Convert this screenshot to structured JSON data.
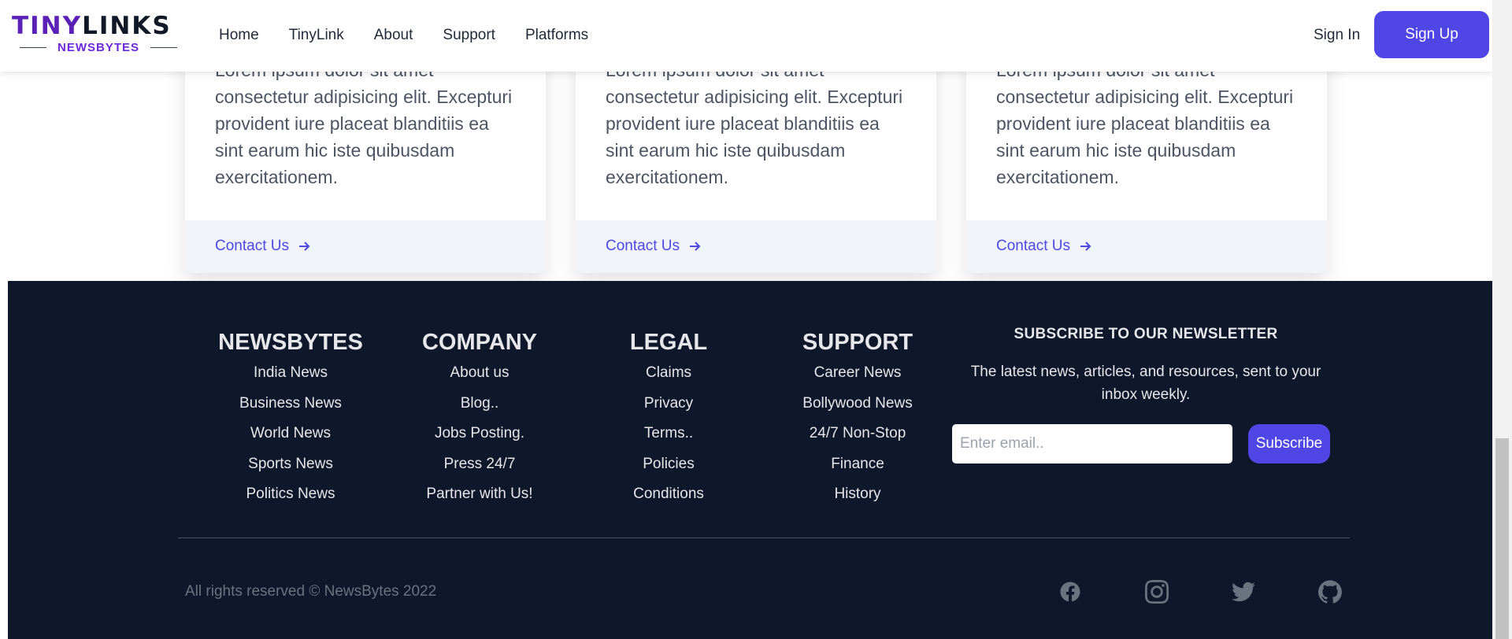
{
  "header": {
    "logo": {
      "brand_part1": "TINY",
      "brand_part2": "LINKS",
      "subtitle": "NEWSBYTES"
    },
    "nav": [
      {
        "label": "Home"
      },
      {
        "label": "TinyLink"
      },
      {
        "label": "About"
      },
      {
        "label": "Support"
      },
      {
        "label": "Platforms"
      }
    ],
    "signin_label": "Sign In",
    "signup_label": "Sign Up"
  },
  "cards": [
    {
      "text": "Lorem ipsum dolor sit amet consectetur adipisicing elit. Excepturi provident iure placeat blanditiis ea sint earum hic iste quibusdam exercitationem.",
      "link_label": "Contact Us"
    },
    {
      "text": "Lorem ipsum dolor sit amet consectetur adipisicing elit. Excepturi provident iure placeat blanditiis ea sint earum hic iste quibusdam exercitationem.",
      "link_label": "Contact Us"
    },
    {
      "text": "Lorem ipsum dolor sit amet consectetur adipisicing elit. Excepturi provident iure placeat blanditiis ea sint earum hic iste quibusdam exercitationem.",
      "link_label": "Contact Us"
    }
  ],
  "footer": {
    "columns": [
      {
        "title": "NEWSBYTES",
        "items": [
          "India News",
          "Business News",
          "World News",
          "Sports News",
          "Politics News"
        ]
      },
      {
        "title": "COMPANY",
        "items": [
          "About us",
          "Blog..",
          "Jobs Posting.",
          "Press 24/7",
          "Partner with Us!"
        ]
      },
      {
        "title": "LEGAL",
        "items": [
          "Claims",
          "Privacy",
          "Terms..",
          "Policies",
          "Conditions"
        ]
      },
      {
        "title": "SUPPORT",
        "items": [
          "Career News",
          "Bollywood News",
          "24/7 Non-Stop",
          "Finance",
          "History"
        ]
      }
    ],
    "newsletter": {
      "title": "SUBSCRIBE TO OUR NEWSLETTER",
      "description": "The latest news, articles, and resources, sent to your inbox weekly.",
      "email_placeholder": "Enter email..",
      "email_value": "",
      "subscribe_label": "Subscribe"
    },
    "copyright": "All rights reserved © NewsBytes 2022",
    "social_icons": [
      "facebook-icon",
      "instagram-icon",
      "twitter-icon",
      "github-icon"
    ]
  },
  "colors": {
    "accent": "#4f46e5",
    "brand_purple": "#5b21b6",
    "footer_bg": "#0f172a",
    "card_footer_bg": "#f0f4f9"
  }
}
